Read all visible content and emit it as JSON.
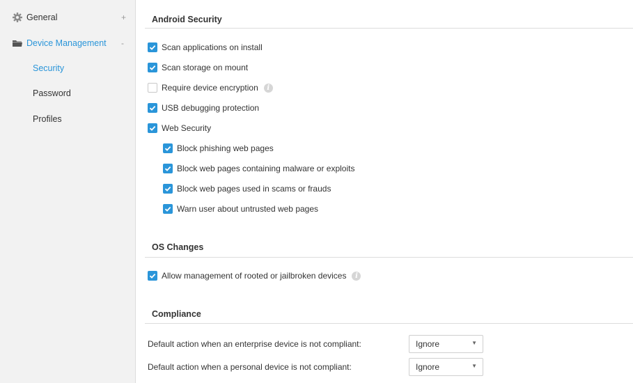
{
  "sidebar": {
    "general": {
      "label": "General",
      "toggle": "+",
      "icon": "gear-icon"
    },
    "device_management": {
      "label": "Device Management",
      "toggle": "-",
      "icon": "folder-icon"
    },
    "sub_items": [
      {
        "label": "Security",
        "active": true
      },
      {
        "label": "Password",
        "active": false
      },
      {
        "label": "Profiles",
        "active": false
      }
    ]
  },
  "android_security": {
    "title": "Android Security",
    "options": [
      {
        "label": "Scan applications on install",
        "checked": true
      },
      {
        "label": "Scan storage on mount",
        "checked": true
      },
      {
        "label": "Require device encryption",
        "checked": false,
        "info": "i"
      },
      {
        "label": "USB debugging protection",
        "checked": true
      },
      {
        "label": "Web Security",
        "checked": true
      }
    ],
    "web_security_options": [
      {
        "label": "Block phishing web pages",
        "checked": true
      },
      {
        "label": "Block web pages containing malware or exploits",
        "checked": true
      },
      {
        "label": "Block web pages used in scams or frauds",
        "checked": true
      },
      {
        "label": "Warn user about untrusted web pages",
        "checked": true
      }
    ]
  },
  "os_changes": {
    "title": "OS Changes",
    "options": [
      {
        "label": "Allow management of rooted or jailbroken devices",
        "checked": true,
        "info": "i"
      }
    ]
  },
  "compliance": {
    "title": "Compliance",
    "rows": [
      {
        "label": "Default action when an enterprise device is not compliant:",
        "value": "Ignore"
      },
      {
        "label": "Default action when a personal device is not compliant:",
        "value": "Ignore"
      }
    ]
  },
  "colors": {
    "accent": "#2a95d9",
    "sidebar_bg": "#f2f2f2",
    "text": "#333333",
    "border": "#dcdcdc"
  }
}
